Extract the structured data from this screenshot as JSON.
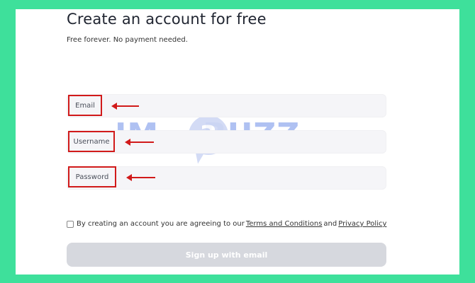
{
  "form": {
    "title": "Create an account for free",
    "subtitle": "Free forever. No payment needed.",
    "fields": [
      {
        "label": "Email"
      },
      {
        "label": "Username"
      },
      {
        "label": "Password"
      }
    ],
    "agreement": {
      "prefix": "By creating an account you are agreeing to our",
      "terms_link": "Terms and Conditions",
      "conjunction": "and",
      "privacy_link": "Privacy Policy"
    },
    "submit_label": "Sign up with email"
  },
  "watermark": {
    "left_text": "IM",
    "bubble_text": "3",
    "right_text": "BUZZ"
  },
  "colors": {
    "background": "#3ee09b",
    "annotation_red": "#d11a1a",
    "field_bg": "#f5f5f8",
    "button_disabled": "#d6d8de",
    "watermark": "#6f8fe8"
  },
  "icons": [
    "red-arrow-icon",
    "checkbox-icon"
  ]
}
